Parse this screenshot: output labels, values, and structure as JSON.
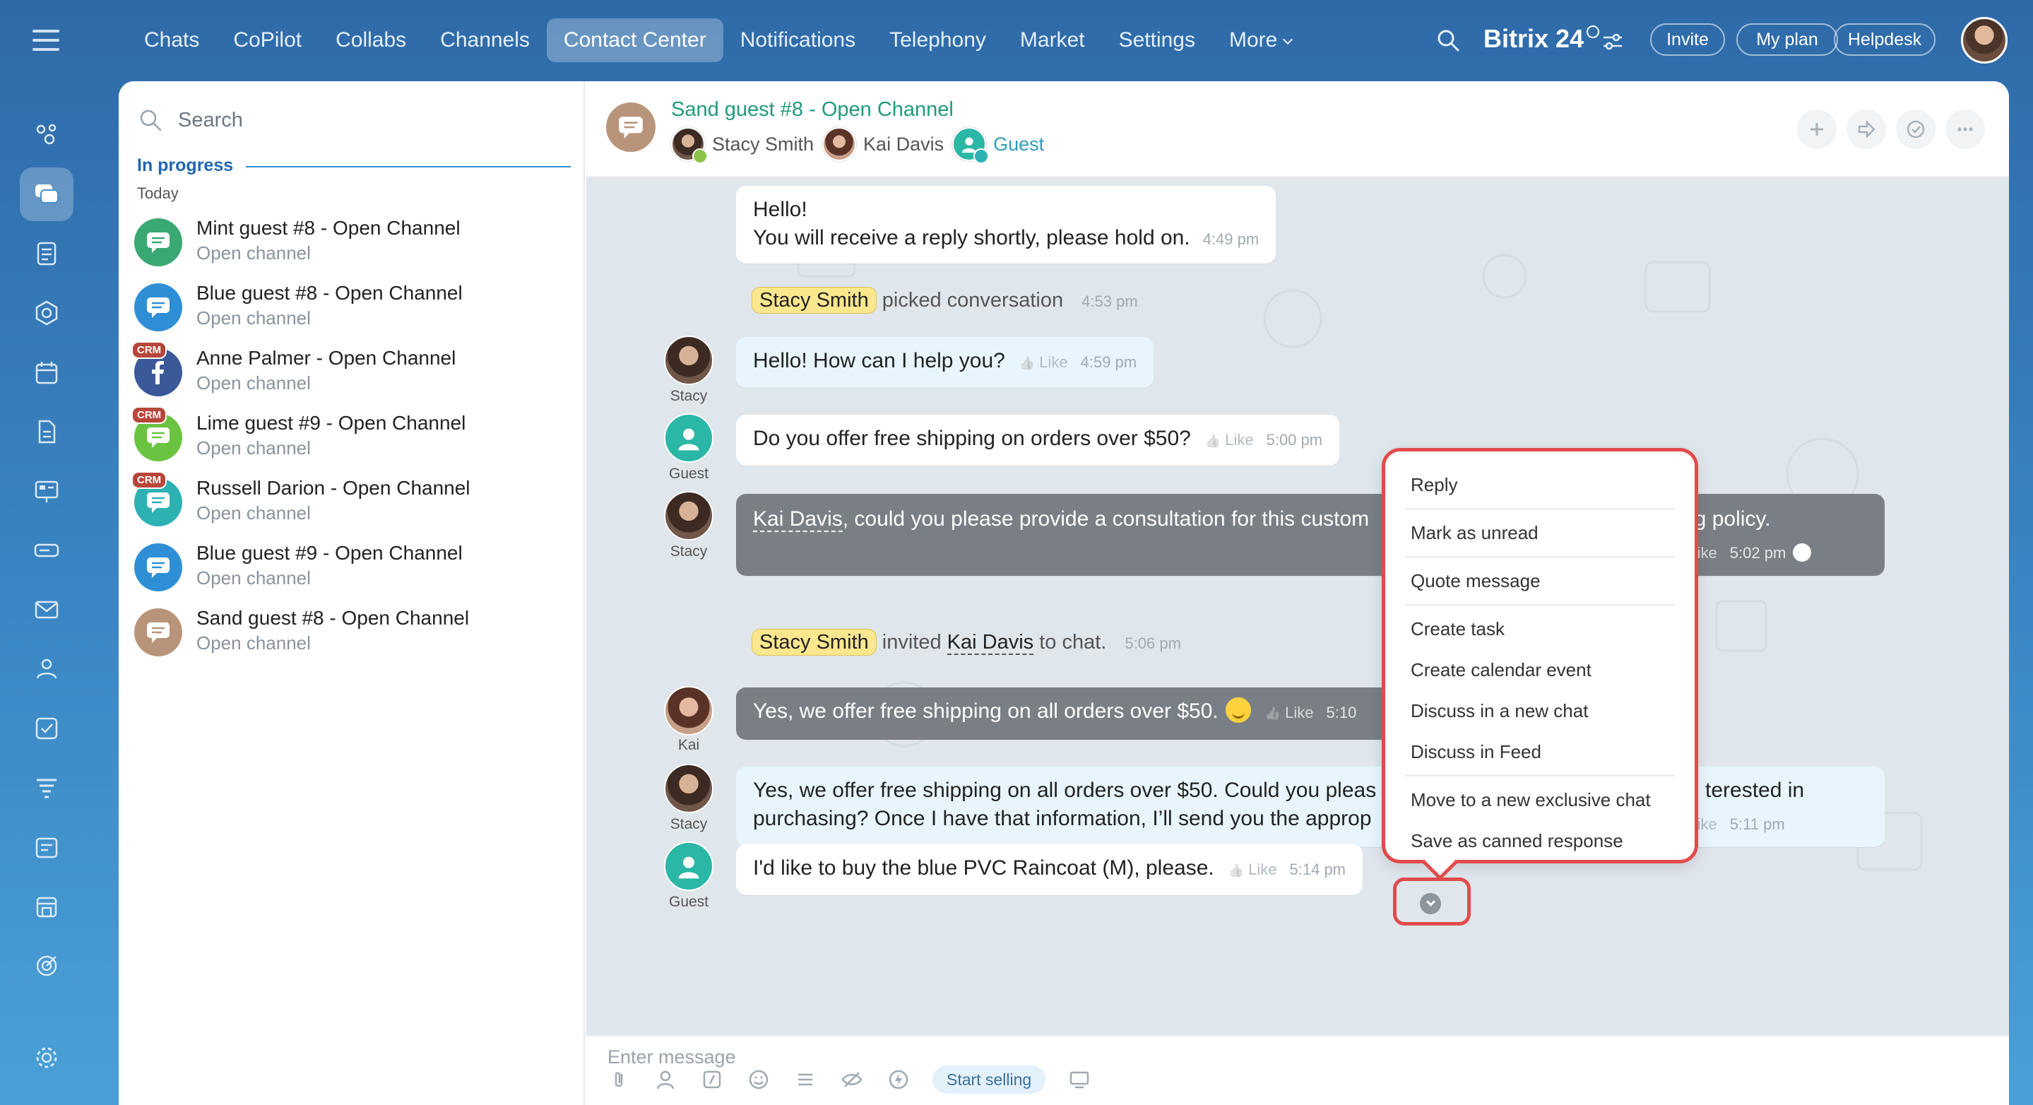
{
  "topnav": {
    "items": [
      "Chats",
      "CoPilot",
      "Collabs",
      "Channels",
      "Contact Center",
      "Notifications",
      "Telephony",
      "Market",
      "Settings",
      "More"
    ],
    "active_index": 4,
    "brand": "Bitrix 24",
    "invite": "Invite",
    "my_plan": "My plan",
    "helpdesk": "Helpdesk"
  },
  "sidebar": {
    "search_placeholder": "Search",
    "section_title": "In progress",
    "section_sub": "Today",
    "chats": [
      {
        "title": "Mint guest #8 - Open Channel",
        "subtitle": "Open channel",
        "color": "#3aa872",
        "crm": false,
        "icon": "chat-icon"
      },
      {
        "title": "Blue guest #8 - Open Channel",
        "subtitle": "Open channel",
        "color": "#2f8fd6",
        "crm": false,
        "icon": "chat-icon"
      },
      {
        "title": "Anne Palmer - Open Channel",
        "subtitle": "Open channel",
        "color": "#3b5998",
        "crm": true,
        "icon": "facebook-icon"
      },
      {
        "title": "Lime guest #9 - Open Channel",
        "subtitle": "Open channel",
        "color": "#6ac441",
        "crm": true,
        "icon": "chat-icon"
      },
      {
        "title": "Russell Darion - Open Channel",
        "subtitle": "Open channel",
        "color": "#2eb1b3",
        "crm": true,
        "icon": "chat-icon"
      },
      {
        "title": "Blue guest #9 - Open Channel",
        "subtitle": "Open channel",
        "color": "#2f8fd6",
        "crm": false,
        "icon": "chat-icon"
      },
      {
        "title": "Sand guest #8 - Open Channel",
        "subtitle": "Open channel",
        "color": "#b8957a",
        "crm": false,
        "icon": "chat-icon"
      }
    ]
  },
  "chat": {
    "title": "Sand guest #8 - Open Channel",
    "participants": [
      "Stacy Smith",
      "Kai Davis",
      "Guest"
    ],
    "messages": {
      "m1_line1": "Hello!",
      "m1_line2": "You will receive a reply shortly, please hold on.",
      "m1_time": "4:49 pm",
      "sys1_name": "Stacy Smith",
      "sys1_text": "picked conversation",
      "sys1_time": "4:53 pm",
      "m2_text": "Hello! How can I help you?",
      "m2_time": "4:59 pm",
      "m2_label": "Stacy",
      "m3_text": "Do you offer free shipping on orders over $50?",
      "m3_time": "5:00 pm",
      "m3_label": "Guest",
      "m4_mention": "Kai Davis",
      "m4_text": ", could you please provide a consultation for this custom",
      "m4_tail": "ng policy.",
      "m4_time": "5:02 pm",
      "m4_label": "Stacy",
      "sys2_name": "Stacy Smith",
      "sys2_text": "invited",
      "sys2_target": "Kai Davis",
      "sys2_tail": "to chat.",
      "sys2_time": "5:06 pm",
      "m5_text": "Yes, we offer free shipping on all orders over $50.",
      "m5_time": "5:10",
      "m5_label": "Kai",
      "m6_line1": "Yes, we offer free shipping on all orders over $50. Could you pleas",
      "m6_line1_tail": "terested in",
      "m6_line2": "purchasing? Once I have that information, I’ll send you the approp",
      "m6_time": "5:11 pm",
      "m6_label": "Stacy",
      "m7_text": "I'd like to buy the blue PVC Raincoat (M), please.",
      "m7_time": "5:14 pm",
      "m7_label": "Guest",
      "like": "Like"
    }
  },
  "context_menu": {
    "items": [
      "Reply",
      "Mark as unread",
      "Quote message",
      "Create task",
      "Create calendar event",
      "Discuss in a new chat",
      "Discuss in Feed",
      "Move to a new exclusive chat",
      "Save as canned response"
    ]
  },
  "composer": {
    "placeholder": "Enter message",
    "start_selling": "Start selling"
  },
  "colors": {
    "accent": "#2067b0",
    "highlight": "#e14b4b",
    "guest": "#2bb7a6"
  }
}
